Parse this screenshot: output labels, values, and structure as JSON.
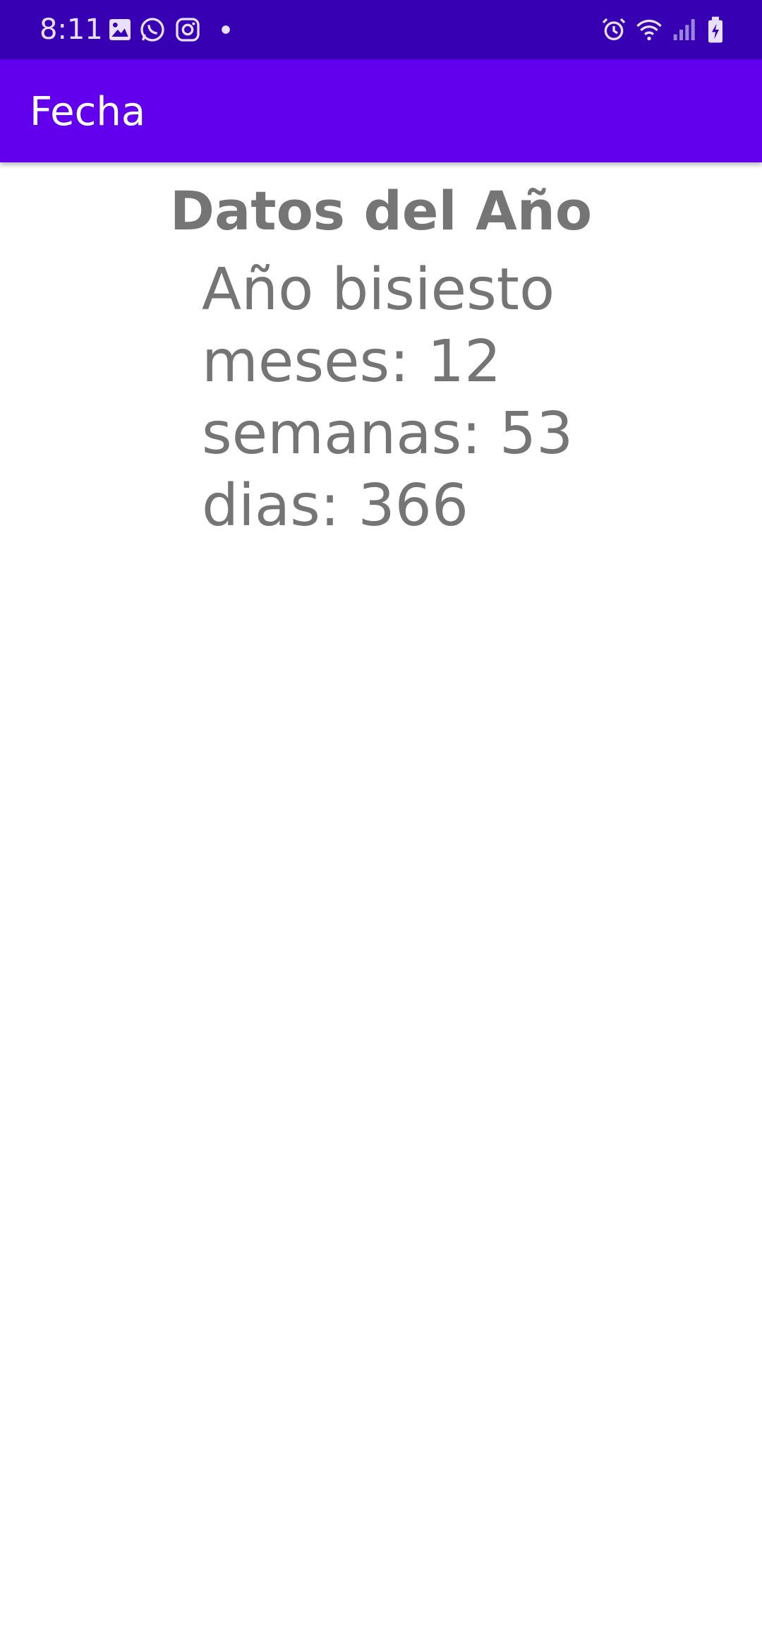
{
  "status_bar": {
    "time": "8:11",
    "icons_left": [
      "gallery-icon",
      "whatsapp-icon",
      "instagram-icon",
      "dot-icon"
    ],
    "icons_right": [
      "alarm-icon",
      "wifi-icon",
      "signal-icon",
      "battery-charging-icon"
    ],
    "background": "#3700b3"
  },
  "app_bar": {
    "title": "Fecha",
    "background": "#6200ee"
  },
  "main": {
    "heading": "Datos del Año",
    "year_type": "Año bisiesto",
    "months": "meses: 12",
    "weeks": "semanas: 53",
    "days": "dias: 366",
    "text_color": "#757575"
  }
}
